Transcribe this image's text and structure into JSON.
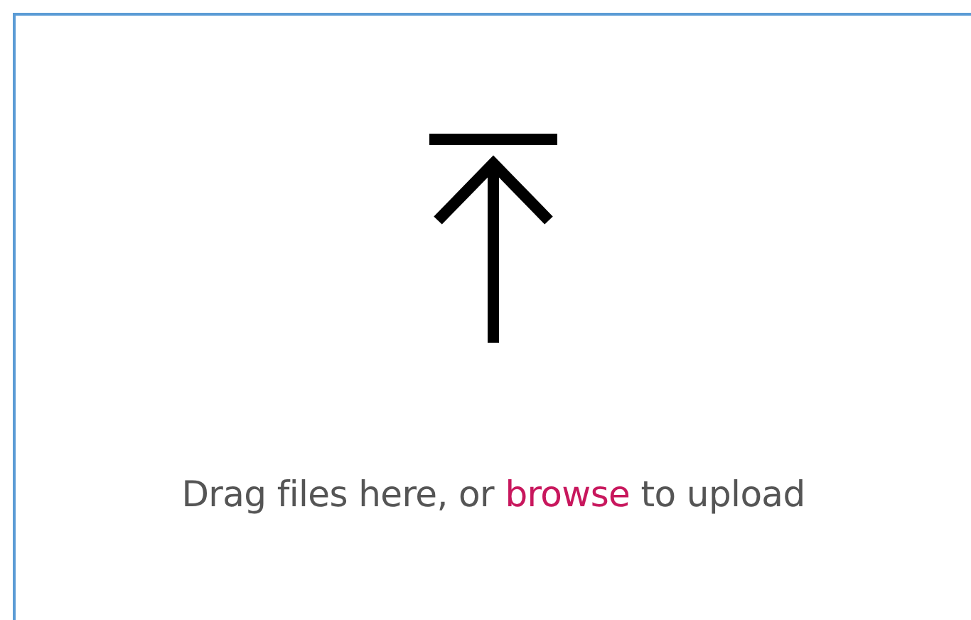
{
  "dropzone": {
    "prompt_before": "Drag files here, or ",
    "link": "browse",
    "prompt_after": " to upload"
  }
}
